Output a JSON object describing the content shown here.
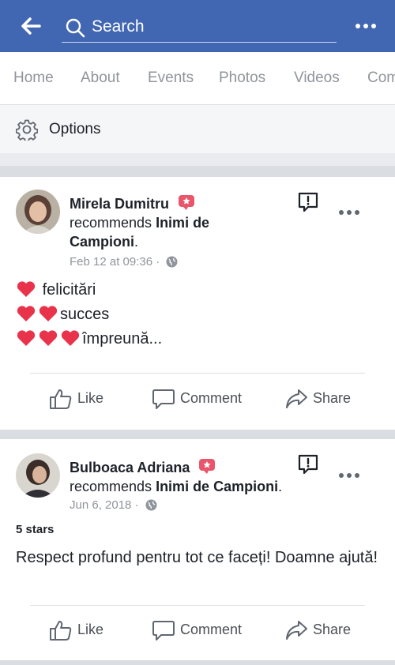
{
  "header": {
    "search_placeholder": "Search",
    "back_icon": "back-arrow-icon",
    "menu_icon": "more-dots-icon",
    "color": "#4267b2"
  },
  "tabs": [
    {
      "label": "Home"
    },
    {
      "label": "About"
    },
    {
      "label": "Events"
    },
    {
      "label": "Photos"
    },
    {
      "label": "Videos"
    },
    {
      "label": "Com"
    }
  ],
  "options": {
    "label": "Options",
    "icon": "gear-icon"
  },
  "posts": [
    {
      "author": "Mirela Dumitru",
      "recommends_text": "recommends",
      "page_name": "Inimi de Campioni",
      "timestamp": "Feb 12 at 09:36",
      "lines": [
        {
          "hearts": 1,
          "text": "felicitări"
        },
        {
          "hearts": 2,
          "text": "succes"
        },
        {
          "hearts": 3,
          "text": "împreună..."
        }
      ],
      "actions": {
        "like": "Like",
        "comment": "Comment",
        "share": "Share"
      }
    },
    {
      "author": "Bulboaca Adriana",
      "recommends_text": "recommends",
      "page_name": "Inimi de Campioni",
      "timestamp": "Jun 6, 2018",
      "rating": "5 stars",
      "text": "Respect profund pentru tot ce faceți! Doamne ajută!",
      "actions": {
        "like": "Like",
        "comment": "Comment",
        "share": "Share"
      }
    }
  ],
  "colors": {
    "text_secondary": "#90949c",
    "badge": "#e9556b",
    "heart": "#e8334a"
  }
}
